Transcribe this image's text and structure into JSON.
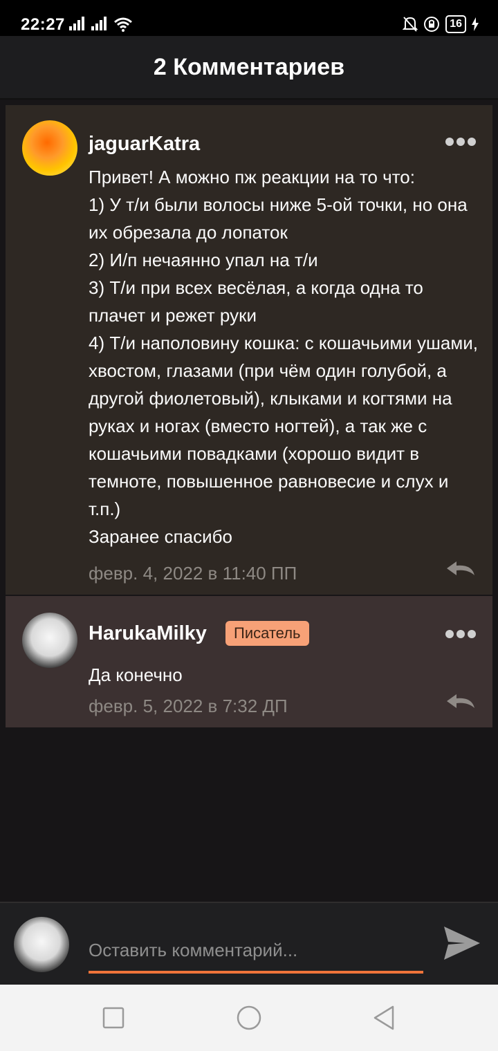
{
  "status": {
    "time": "22:27",
    "battery": "16"
  },
  "header": {
    "title": "2 Комментариев"
  },
  "comments": [
    {
      "username": "jaguarKatra",
      "text": "Привет! А можно пж реакции на то что:\n1) У т/и были волосы ниже 5-ой точки, но она их обрезала до лопаток\n2) И/п нечаянно упал на т/и\n3) Т/и при всех весёлая, а когда одна то плачет и режет руки\n4) Т/и наполовину кошка: с кошачьими ушами, хвостом, глазами (при чём один голубой, а другой фиолетовый), клыками и когтями на руках и ногах (вместо ногтей), а так же с кошачьими повадками (хорошо видит в темноте,  повышенное равновесие и слух и т.п.)\nЗаранее спасибо",
      "timestamp": "февр. 4, 2022 в 11:40 ПП"
    },
    {
      "username": "HarukaMilky",
      "badge": "Писатель",
      "text": "Да конечно",
      "timestamp": "февр. 5, 2022 в 7:32 ДП"
    }
  ],
  "composer": {
    "placeholder": "Оставить комментарий..."
  },
  "colors": {
    "accent": "#f0743a",
    "badge": "#f7a177",
    "comment_bg_1": "#2e2823",
    "comment_bg_2": "#3c3131"
  }
}
